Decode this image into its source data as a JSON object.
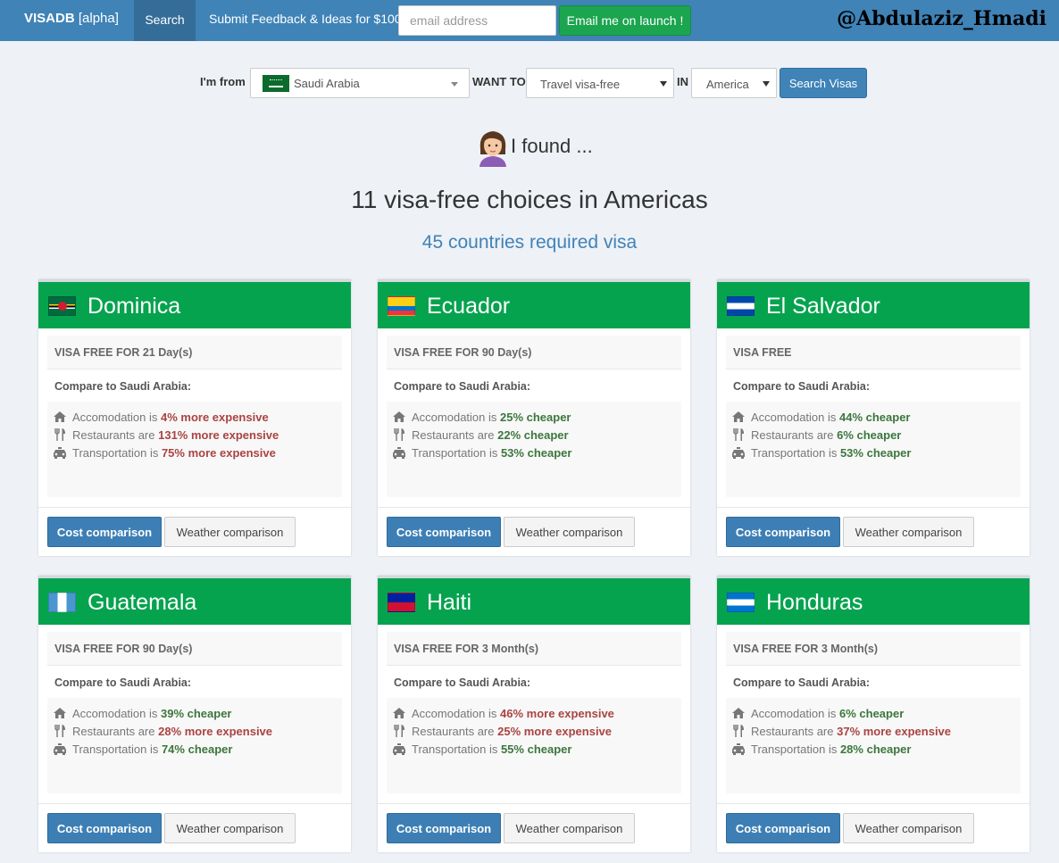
{
  "navbar": {
    "brand": "VISADB",
    "brand_tag": "[alpha]",
    "search_label": "Search",
    "feedback_label": "Submit Feedback & Ideas for $100",
    "email_placeholder": "email address",
    "email_button": "Email me on launch !",
    "handle": "@Abdulaziz_Hmadi"
  },
  "search_form": {
    "from_label": "I'm from",
    "from_value": "Saudi Arabia",
    "want_label": "WANT TO",
    "want_value": "Travel visa-free",
    "in_label": "IN",
    "in_value": "America",
    "submit_label": "Search Visas"
  },
  "results": {
    "found_text": "I found ...",
    "headline": "11 visa-free choices in Americas",
    "required_link": "45 countries required visa"
  },
  "cards": [
    {
      "country": "Dominica",
      "duration": "VISA FREE FOR 21 Day(s)",
      "compare_label": "Compare to Saudi Arabia:",
      "accommodation": {
        "prefix": "Accomodation is ",
        "value": "4% more expensive",
        "status": "expensive"
      },
      "restaurants": {
        "prefix": "Restaurants are ",
        "value": "131% more expensive",
        "status": "expensive"
      },
      "transportation": {
        "prefix": "Transportation is ",
        "value": "75% more expensive",
        "status": "expensive"
      },
      "cost_button": "Cost comparison",
      "weather_button": "Weather comparison"
    },
    {
      "country": "Ecuador",
      "duration": "VISA FREE FOR 90 Day(s)",
      "compare_label": "Compare to Saudi Arabia:",
      "accommodation": {
        "prefix": "Accomodation is ",
        "value": "25% cheaper",
        "status": "cheaper"
      },
      "restaurants": {
        "prefix": "Restaurants are ",
        "value": "22% cheaper",
        "status": "cheaper"
      },
      "transportation": {
        "prefix": "Transportation is ",
        "value": "53% cheaper",
        "status": "cheaper"
      },
      "cost_button": "Cost comparison",
      "weather_button": "Weather comparison"
    },
    {
      "country": "El Salvador",
      "duration": "VISA FREE",
      "compare_label": "Compare to Saudi Arabia:",
      "accommodation": {
        "prefix": "Accomodation is ",
        "value": "44% cheaper",
        "status": "cheaper"
      },
      "restaurants": {
        "prefix": "Restaurants are ",
        "value": "6% cheaper",
        "status": "cheaper"
      },
      "transportation": {
        "prefix": "Transportation is ",
        "value": "53% cheaper",
        "status": "cheaper"
      },
      "cost_button": "Cost comparison",
      "weather_button": "Weather comparison"
    },
    {
      "country": "Guatemala",
      "duration": "VISA FREE FOR 90 Day(s)",
      "compare_label": "Compare to Saudi Arabia:",
      "accommodation": {
        "prefix": "Accomodation is ",
        "value": "39% cheaper",
        "status": "cheaper"
      },
      "restaurants": {
        "prefix": "Restaurants are ",
        "value": "28% more expensive",
        "status": "expensive"
      },
      "transportation": {
        "prefix": "Transportation is ",
        "value": "74% cheaper",
        "status": "cheaper"
      },
      "cost_button": "Cost comparison",
      "weather_button": "Weather comparison"
    },
    {
      "country": "Haiti",
      "duration": "VISA FREE FOR 3 Month(s)",
      "compare_label": "Compare to Saudi Arabia:",
      "accommodation": {
        "prefix": "Accomodation is ",
        "value": "46% more expensive",
        "status": "expensive"
      },
      "restaurants": {
        "prefix": "Restaurants are ",
        "value": "25% more expensive",
        "status": "expensive"
      },
      "transportation": {
        "prefix": "Transportation is ",
        "value": "55% cheaper",
        "status": "cheaper"
      },
      "cost_button": "Cost comparison",
      "weather_button": "Weather comparison"
    },
    {
      "country": "Honduras",
      "duration": "VISA FREE FOR 3 Month(s)",
      "compare_label": "Compare to Saudi Arabia:",
      "accommodation": {
        "prefix": "Accomodation is ",
        "value": "6% cheaper",
        "status": "cheaper"
      },
      "restaurants": {
        "prefix": "Restaurants are ",
        "value": "37% more expensive",
        "status": "expensive"
      },
      "transportation": {
        "prefix": "Transportation is ",
        "value": "28% cheaper",
        "status": "cheaper"
      },
      "cost_button": "Cost comparison",
      "weather_button": "Weather comparison"
    }
  ],
  "colors": {
    "navbar": "#3f83b7",
    "card_header": "#06a34f",
    "expensive": "#a94442",
    "cheaper": "#3c763d",
    "page_background": "#eef1f6"
  },
  "icons": {
    "accommodation": "home-icon",
    "restaurants": "cutlery-icon",
    "transportation": "taxi-icon"
  }
}
